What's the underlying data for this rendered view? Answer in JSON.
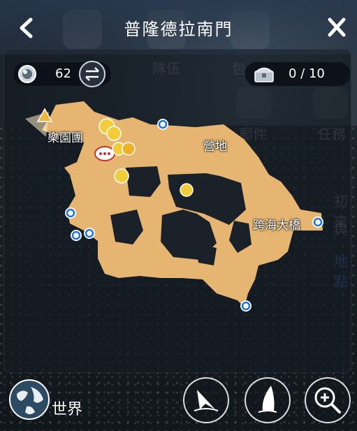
{
  "header": {
    "title": "普隆德拉南門"
  },
  "counters": {
    "orb_count": "62",
    "chest_count": "0 / 10"
  },
  "map": {
    "places": [
      {
        "name": "樂園團"
      },
      {
        "name": "營地"
      },
      {
        "name": "跨海大橋"
      }
    ]
  },
  "background_menu": {
    "items": [
      "隊伍",
      "包",
      "郵件",
      "任務",
      "初來",
      "與",
      "地點"
    ]
  },
  "footer": {
    "world_label": "世界"
  },
  "colors": {
    "map_fill": "#e6b571",
    "waypoint": "#1e73d8",
    "panel": "#141a22"
  }
}
